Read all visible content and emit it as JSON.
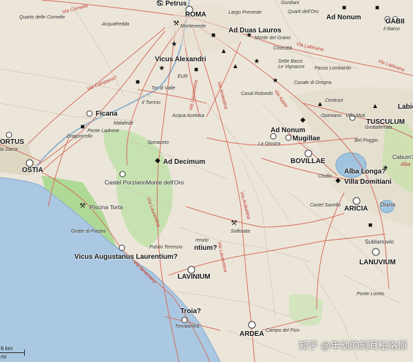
{
  "map": {
    "towns": [
      {
        "name": "ROMA",
        "kind": "big"
      },
      {
        "name": "Ad Duas Lauros",
        "kind": "big"
      },
      {
        "name": "Ad Nonum",
        "kind": "big"
      },
      {
        "name": "GABII",
        "kind": "big"
      },
      {
        "name": "Vicus Alexandri",
        "kind": "big"
      },
      {
        "name": "Ficana",
        "kind": "big"
      },
      {
        "name": "Ad Decimum",
        "kind": "big"
      },
      {
        "name": "TUSCULUM",
        "kind": "big"
      },
      {
        "name": "Ad Nonum",
        "kind": "big"
      },
      {
        "name": "Mugillae",
        "kind": "big"
      },
      {
        "name": "BOVILLAE",
        "kind": "big"
      },
      {
        "name": "Alba Longa?",
        "kind": "big"
      },
      {
        "name": "Villa Domitiani",
        "kind": "big"
      },
      {
        "name": "ARICIA",
        "kind": "big"
      },
      {
        "name": "OSTIA",
        "kind": "big"
      },
      {
        "name": "PORTUS",
        "kind": "big"
      },
      {
        "name": "Vicus Augustanus Laurentium?",
        "kind": "big"
      },
      {
        "name": "LAVINIUM",
        "kind": "big"
      },
      {
        "name": "LANUVIUM",
        "kind": "big"
      },
      {
        "name": "ARDEA",
        "kind": "big"
      },
      {
        "name": "Troia?",
        "kind": "big"
      },
      {
        "name": "S. Petrus",
        "kind": "big"
      },
      {
        "name": "Castel Porziano",
        "kind": "med"
      },
      {
        "name": "Monte dell'Oro",
        "kind": "med"
      },
      {
        "name": "Sublanuvio",
        "kind": "med"
      },
      {
        "name": "Diana",
        "kind": "med"
      },
      {
        "name": "Piscina Torta",
        "kind": "med"
      },
      {
        "name": "Cabum?",
        "kind": "med"
      }
    ],
    "small_labels": [
      "Quarto delle Cornelie",
      "Acquafredda",
      "Gordiani",
      "Largo Preneste",
      "Quarti dell'Oro",
      "Il Barco",
      "Monteverde",
      "Monte del Grano",
      "Cinecittà",
      "Sette Bassi",
      "Le Vignacce",
      "Passo Lombardo",
      "EUR",
      "Tor di Valle",
      "Il Torrino",
      "Casal Rotondo",
      "Casale di Gregna",
      "Centroni",
      "Opimiano",
      "Villa Muti",
      "Grottaferrata",
      "Acqua Acetosa",
      "Malafede",
      "Ponte Ladrone",
      "Dragoncello",
      "Spinaceto",
      "La Giostra",
      "Bel Poggio",
      "Clodio",
      "Castel Savello",
      "Solforata",
      "Grotte di Piastra",
      "Publio Terenzio",
      "Ponte Loreto",
      "Campo del Fico",
      "Torvaianica",
      "Isola Sacra"
    ],
    "road_labels": [
      "Via Cornelia",
      "Via Campana?",
      "Via Labicana",
      "Via Latina",
      "Via Appia",
      "Via Ardeatina",
      "Via Laurentina",
      "Via Severiana",
      "Via Ostiensis",
      "Via Portuensis"
    ],
    "partial_labels": [
      "ORTUS",
      "Labic",
      "Alba",
      "ntium?",
      "renzio",
      "la Sacra"
    ],
    "scale": {
      "km": "6 km",
      "mi": "mi"
    },
    "watermark": "知乎 @年幼的刻耳柏洛斯",
    "colors": {
      "sea": "#aac8e2",
      "land": "#ece6da",
      "green": "#b9dca0",
      "road": "#d66a5a",
      "lake": "#9fc4e0"
    }
  }
}
